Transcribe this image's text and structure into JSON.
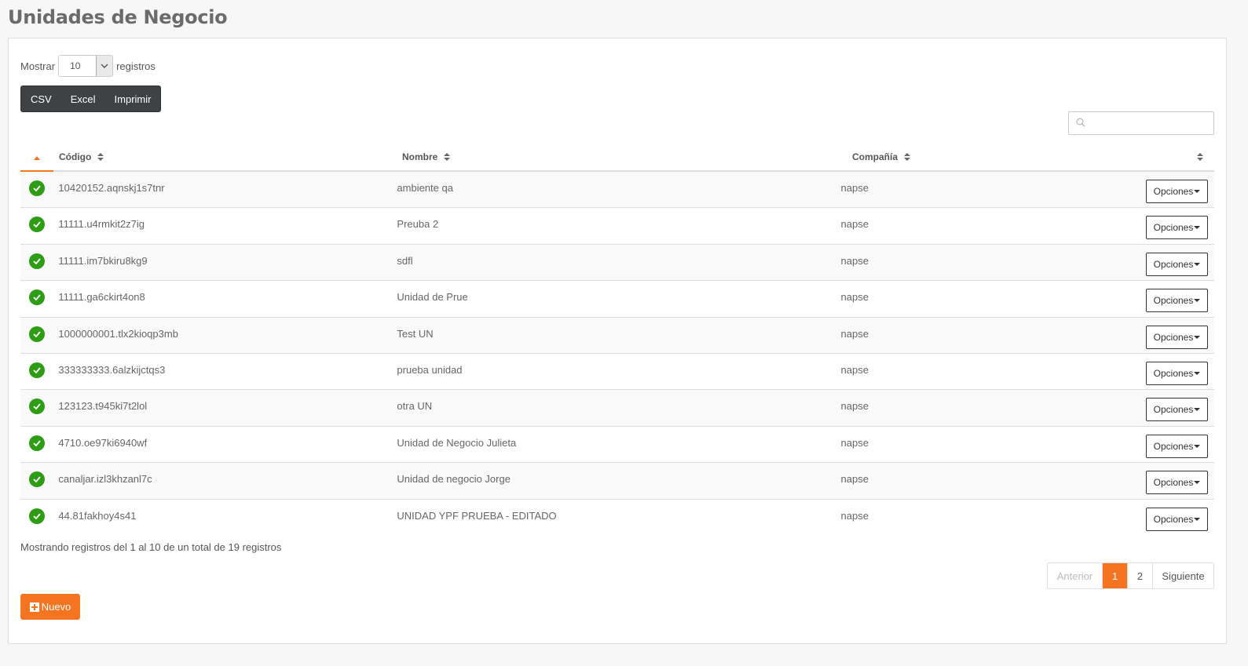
{
  "page": {
    "title": "Unidades de Negocio"
  },
  "length": {
    "prefix": "Mostrar",
    "value": "10",
    "suffix": "registros"
  },
  "export": {
    "csv": "CSV",
    "excel": "Excel",
    "print": "Imprimir"
  },
  "search": {
    "placeholder": ""
  },
  "table": {
    "headers": {
      "code": "Código",
      "name": "Nombre",
      "company": "Compañía"
    },
    "rows": [
      {
        "code": "10420152.aqnskj1s7tnr",
        "name": "ambiente qa",
        "company": "napse",
        "action": "Opciones"
      },
      {
        "code": "11111.u4rmkit2z7ig",
        "name": "Preuba 2",
        "company": "napse",
        "action": "Opciones"
      },
      {
        "code": "11111.im7bkiru8kg9",
        "name": "sdfl",
        "company": "napse",
        "action": "Opciones"
      },
      {
        "code": "11111.ga6ckirt4on8",
        "name": "Unidad de Prue",
        "company": "napse",
        "action": "Opciones"
      },
      {
        "code": "1000000001.tlx2kioqp3mb",
        "name": "Test UN",
        "company": "napse",
        "action": "Opciones"
      },
      {
        "code": "333333333.6alzkijctqs3",
        "name": "prueba unidad",
        "company": "napse",
        "action": "Opciones"
      },
      {
        "code": "123123.t945ki7t2lol",
        "name": "otra UN",
        "company": "napse",
        "action": "Opciones"
      },
      {
        "code": "4710.oe97ki6940wf",
        "name": "Unidad de Negocio Julieta",
        "company": "napse",
        "action": "Opciones"
      },
      {
        "code": "canaljar.izl3khzanl7c",
        "name": "Unidad de negocio Jorge",
        "company": "napse",
        "action": "Opciones"
      },
      {
        "code": "44.81fakhoy4s41",
        "name": "UNIDAD YPF PRUEBA - EDITADO",
        "company": "napse",
        "action": "Opciones"
      }
    ]
  },
  "info": "Mostrando registros del 1 al 10 de un total de 19 registros",
  "pagination": {
    "prev": "Anterior",
    "pages": [
      "1",
      "2"
    ],
    "next": "Siguiente",
    "current": "1"
  },
  "new_button": "Nuevo",
  "colors": {
    "accent": "#f47421",
    "success": "#2e9c14",
    "dark": "#3f4244"
  }
}
